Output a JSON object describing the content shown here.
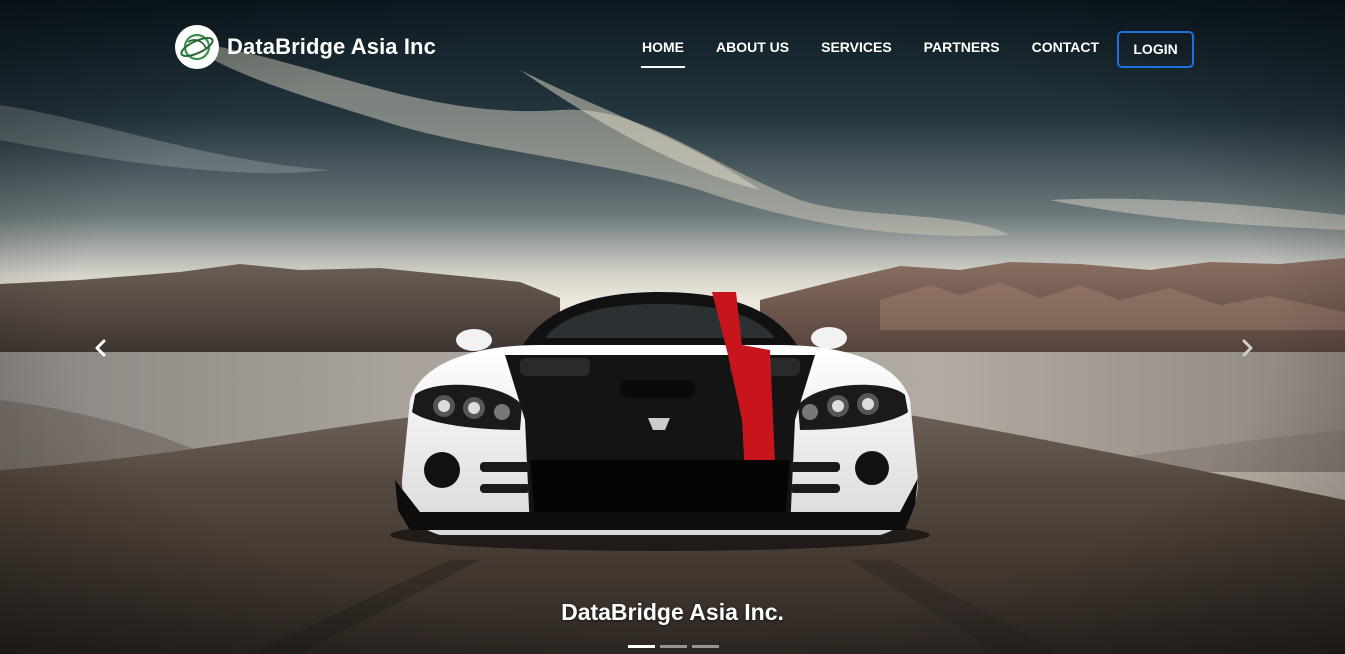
{
  "brand": {
    "name": "DataBridge Asia Inc",
    "logo_icon": "globe-orbit-logo"
  },
  "nav": {
    "items": [
      {
        "label": "HOME",
        "active": true
      },
      {
        "label": "ABOUT US",
        "active": false
      },
      {
        "label": "SERVICES",
        "active": false
      },
      {
        "label": "PARTNERS",
        "active": false
      },
      {
        "label": "CONTACT",
        "active": false
      }
    ],
    "login_label": "LOGIN"
  },
  "carousel": {
    "caption": "DataBridge Asia Inc.",
    "prev_icon": "chevron-left-icon",
    "next_icon": "chevron-right-icon",
    "slide_count": 3,
    "active_slide": 1
  },
  "colors": {
    "login_border": "#1e6fe0",
    "nav_text": "#ffffff",
    "logo_green": "#2e8b3a"
  }
}
